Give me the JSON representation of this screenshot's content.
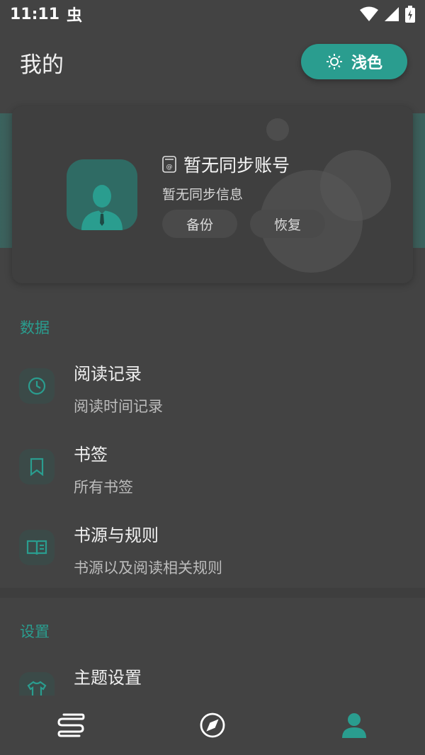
{
  "status_bar": {
    "time": "11:11",
    "app_glyph": "虫"
  },
  "header": {
    "title": "我的",
    "theme_button_label": "浅色"
  },
  "profile": {
    "account_name": "暂无同步账号",
    "sync_info": "暂无同步信息",
    "backup_label": "备份",
    "restore_label": "恢复"
  },
  "sections": {
    "data_title": "数据",
    "settings_title": "设置"
  },
  "items": {
    "reading_history": {
      "title": "阅读记录",
      "subtitle": "阅读时间记录"
    },
    "bookmarks": {
      "title": "书签",
      "subtitle": "所有书签"
    },
    "sources": {
      "title": "书源与规则",
      "subtitle": "书源以及阅读相关规则"
    },
    "theme": {
      "title": "主题设置"
    }
  },
  "colors": {
    "accent": "#2a9d8f",
    "background": "#434343"
  },
  "icons": [
    "wifi-icon",
    "signal-icon",
    "battery-icon",
    "sun-icon",
    "user-icon",
    "clock-icon",
    "bookmark-icon",
    "book-open-icon",
    "shirt-icon",
    "bookshelf-icon",
    "compass-icon",
    "profile-icon"
  ]
}
